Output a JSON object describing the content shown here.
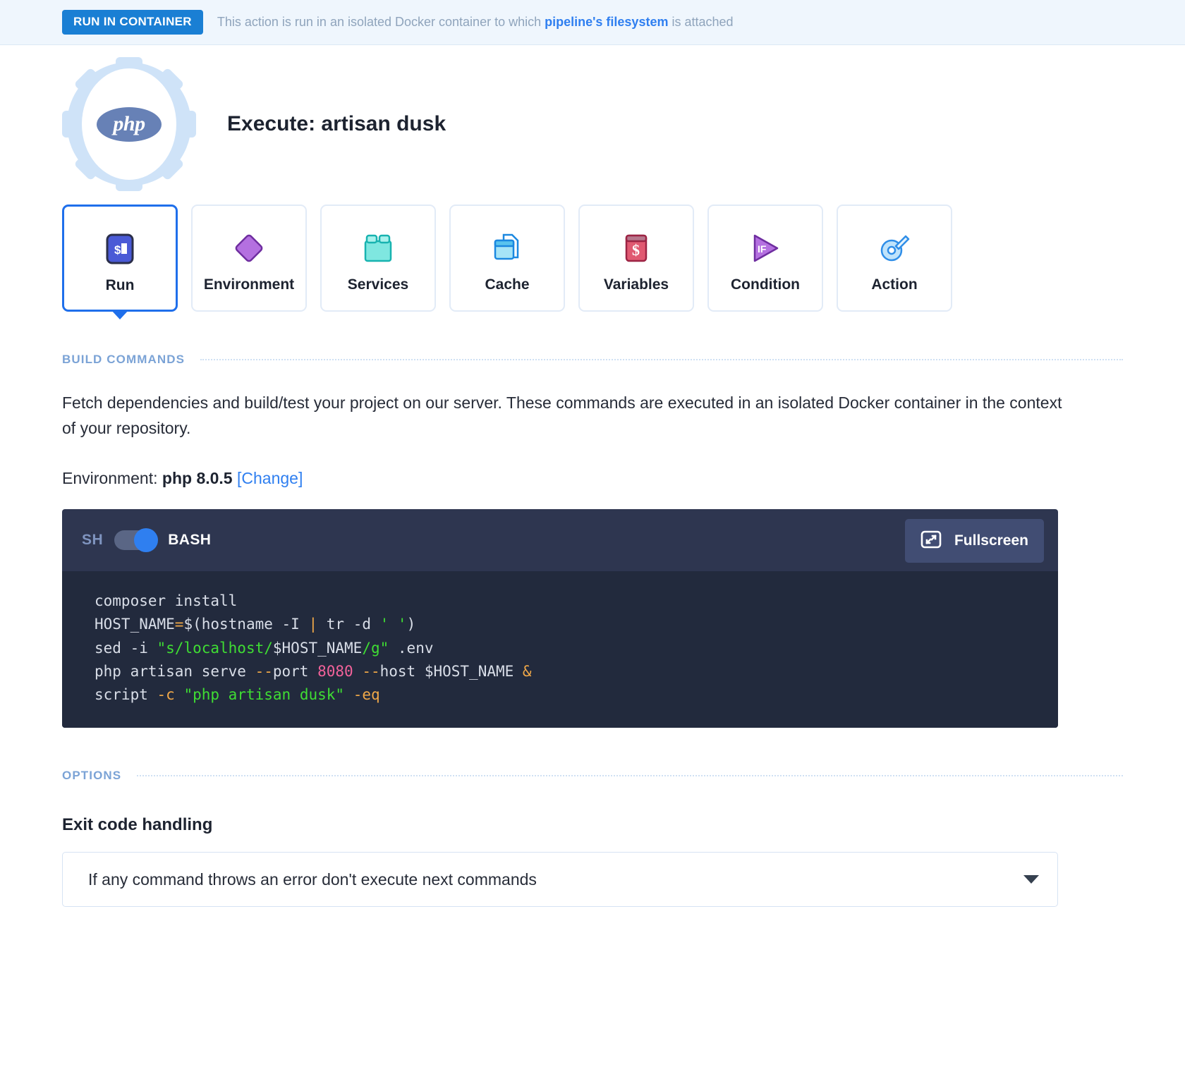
{
  "notice": {
    "badge": "RUN IN CONTAINER",
    "text_before": "This action is run in an isolated Docker container to which ",
    "link": "pipeline's filesystem",
    "text_after": " is attached"
  },
  "action": {
    "icon": "php-gear-icon",
    "title": "Execute: artisan dusk"
  },
  "tabs": [
    {
      "label": "Run",
      "icon": "terminal-prompt-icon",
      "active": true
    },
    {
      "label": "Environment",
      "icon": "purple-diamond-icon",
      "active": false
    },
    {
      "label": "Services",
      "icon": "teal-crates-icon",
      "active": false
    },
    {
      "label": "Cache",
      "icon": "blue-files-icon",
      "active": false
    },
    {
      "label": "Variables",
      "icon": "red-dollar-card-icon",
      "active": false
    },
    {
      "label": "Condition",
      "icon": "purple-if-play-icon",
      "active": false
    },
    {
      "label": "Action",
      "icon": "blue-wrench-gear-icon",
      "active": false
    }
  ],
  "build_commands": {
    "section_title": "BUILD COMMANDS",
    "description": "Fetch dependencies and build/test your project on our server. These commands are executed in an isolated Docker container in the context of your repository.",
    "environment_label": "Environment:",
    "environment_value": "php 8.0.5",
    "environment_change": "[Change]"
  },
  "editor": {
    "toggle_left_label": "SH",
    "toggle_right_label": "BASH",
    "toggle_state": "BASH",
    "fullscreen_label": "Fullscreen",
    "fullscreen_icon": "expand-icon",
    "lines": [
      "composer install",
      "HOST_NAME=$(hostname -I | tr -d ' ')",
      "sed -i \"s/localhost/$HOST_NAME/g\" .env",
      "php artisan serve --port 8080 --host $HOST_NAME &",
      "script -c \"php artisan dusk\" -eq"
    ]
  },
  "options": {
    "section_title": "OPTIONS",
    "exit_code_label": "Exit code handling",
    "exit_code_value": "If any command throws an error don't execute next commands",
    "caret_icon": "chevron-down-icon"
  },
  "colors": {
    "accent_blue": "#2f7ff0",
    "badge_blue": "#1a7fd4",
    "notice_bg": "#eff6fd",
    "editor_bar": "#2e3650",
    "editor_bg": "#222a3d",
    "string_green": "#3fdd33",
    "number_pink": "#f2629a",
    "operator_orange": "#f0a848",
    "section_label": "#7ba3d6"
  }
}
